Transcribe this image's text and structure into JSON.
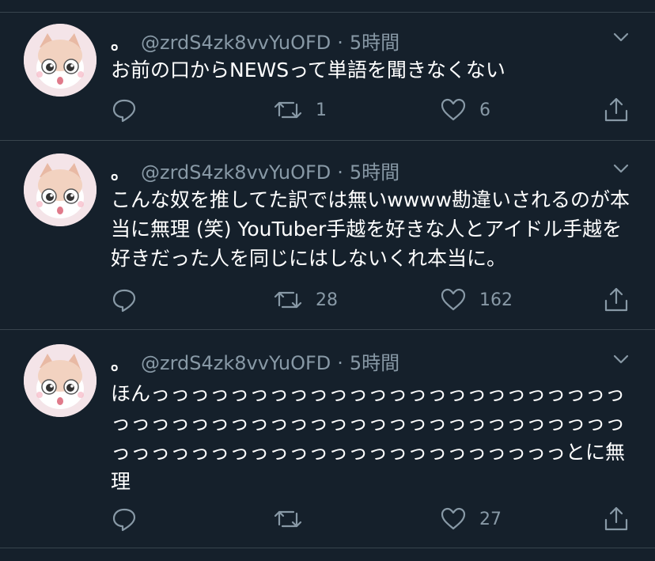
{
  "tweets": [
    {
      "display_name": "。",
      "handle": "@zrdS4zk8vvYuOFD",
      "separator": "·",
      "time": "5時間",
      "text": "お前の口からNEWSって単語を聞きなくない",
      "replies": "",
      "retweets": "1",
      "likes": "6"
    },
    {
      "display_name": "。",
      "handle": "@zrdS4zk8vvYuOFD",
      "separator": "·",
      "time": "5時間",
      "text": "こんな奴を推してた訳では無いwwww勘違いされるのが本当に無理 (笑) YouTuber手越を好きな人とアイドル手越を好きだった人を同じにはしないくれ本当に。",
      "replies": "",
      "retweets": "28",
      "likes": "162"
    },
    {
      "display_name": "。",
      "handle": "@zrdS4zk8vvYuOFD",
      "separator": "·",
      "time": "5時間",
      "text": "ほんっっっっっっっっっっっっっっっっっっっっっっっっっっっっっっっっっっっっっっっっっっっっっっっっっっっっっっっっっっっっっっっっっっっっっっっっっとに無理",
      "replies": "",
      "retweets": "",
      "likes": "27"
    }
  ],
  "icons": {
    "reply": "reply-icon",
    "retweet": "retweet-icon",
    "like": "heart-icon",
    "share": "share-icon",
    "menu": "chevron-down-icon"
  },
  "colors": {
    "background": "#15202b",
    "border": "#38444d",
    "secondary_text": "#8899a6",
    "primary_text": "#ffffff"
  }
}
